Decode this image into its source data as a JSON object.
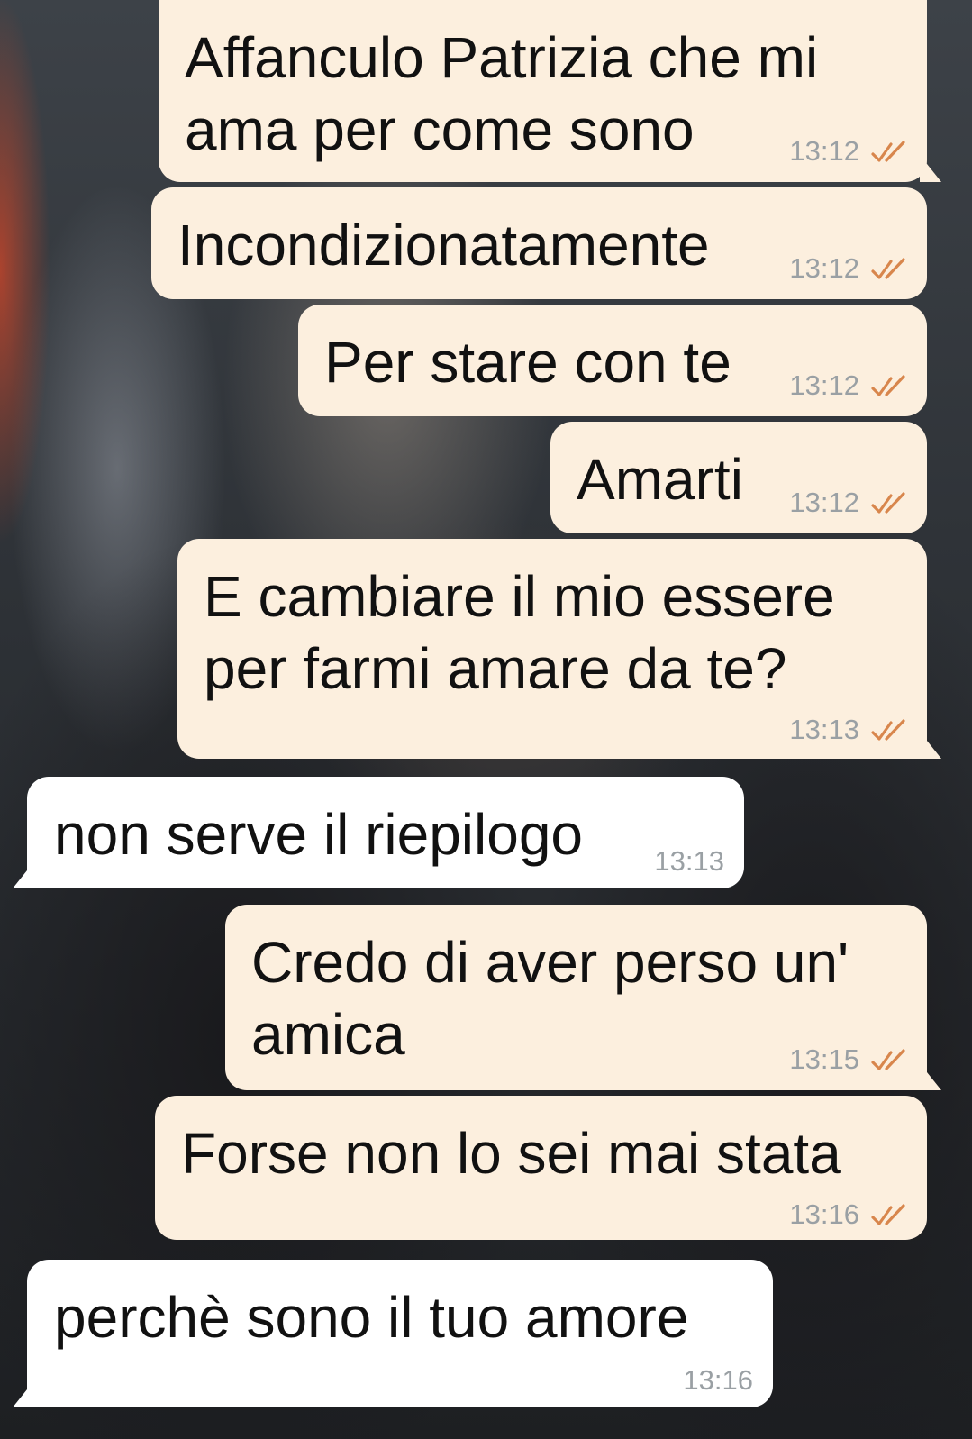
{
  "conversation": {
    "messages": [
      {
        "direction": "outgoing",
        "text": "Affanculo Patrizia che mi\nama per come sono",
        "time": "13:12",
        "status": "read"
      },
      {
        "direction": "outgoing",
        "text": "Incondizionatamente",
        "time": "13:12",
        "status": "read"
      },
      {
        "direction": "outgoing",
        "text": "Per stare con te",
        "time": "13:12",
        "status": "read"
      },
      {
        "direction": "outgoing",
        "text": "Amarti",
        "time": "13:12",
        "status": "read"
      },
      {
        "direction": "outgoing",
        "text": "E cambiare il mio essere\nper farmi amare da te?",
        "time": "13:13",
        "status": "read"
      },
      {
        "direction": "incoming",
        "text": "non serve il riepilogo",
        "time": "13:13"
      },
      {
        "direction": "outgoing",
        "text": "Credo di aver perso un'\namica",
        "time": "13:15",
        "status": "read"
      },
      {
        "direction": "outgoing",
        "text": "Forse non lo sei mai stata",
        "time": "13:16",
        "status": "read"
      },
      {
        "direction": "incoming",
        "text": "perchè sono il tuo amore",
        "time": "13:16"
      }
    ]
  },
  "colors": {
    "outgoing_bubble": "#fcefde",
    "incoming_bubble": "#ffffff",
    "read_ticks": "#d8864c",
    "timestamp": "#9aa0a4"
  },
  "icons": {
    "status": "double-check-icon"
  }
}
